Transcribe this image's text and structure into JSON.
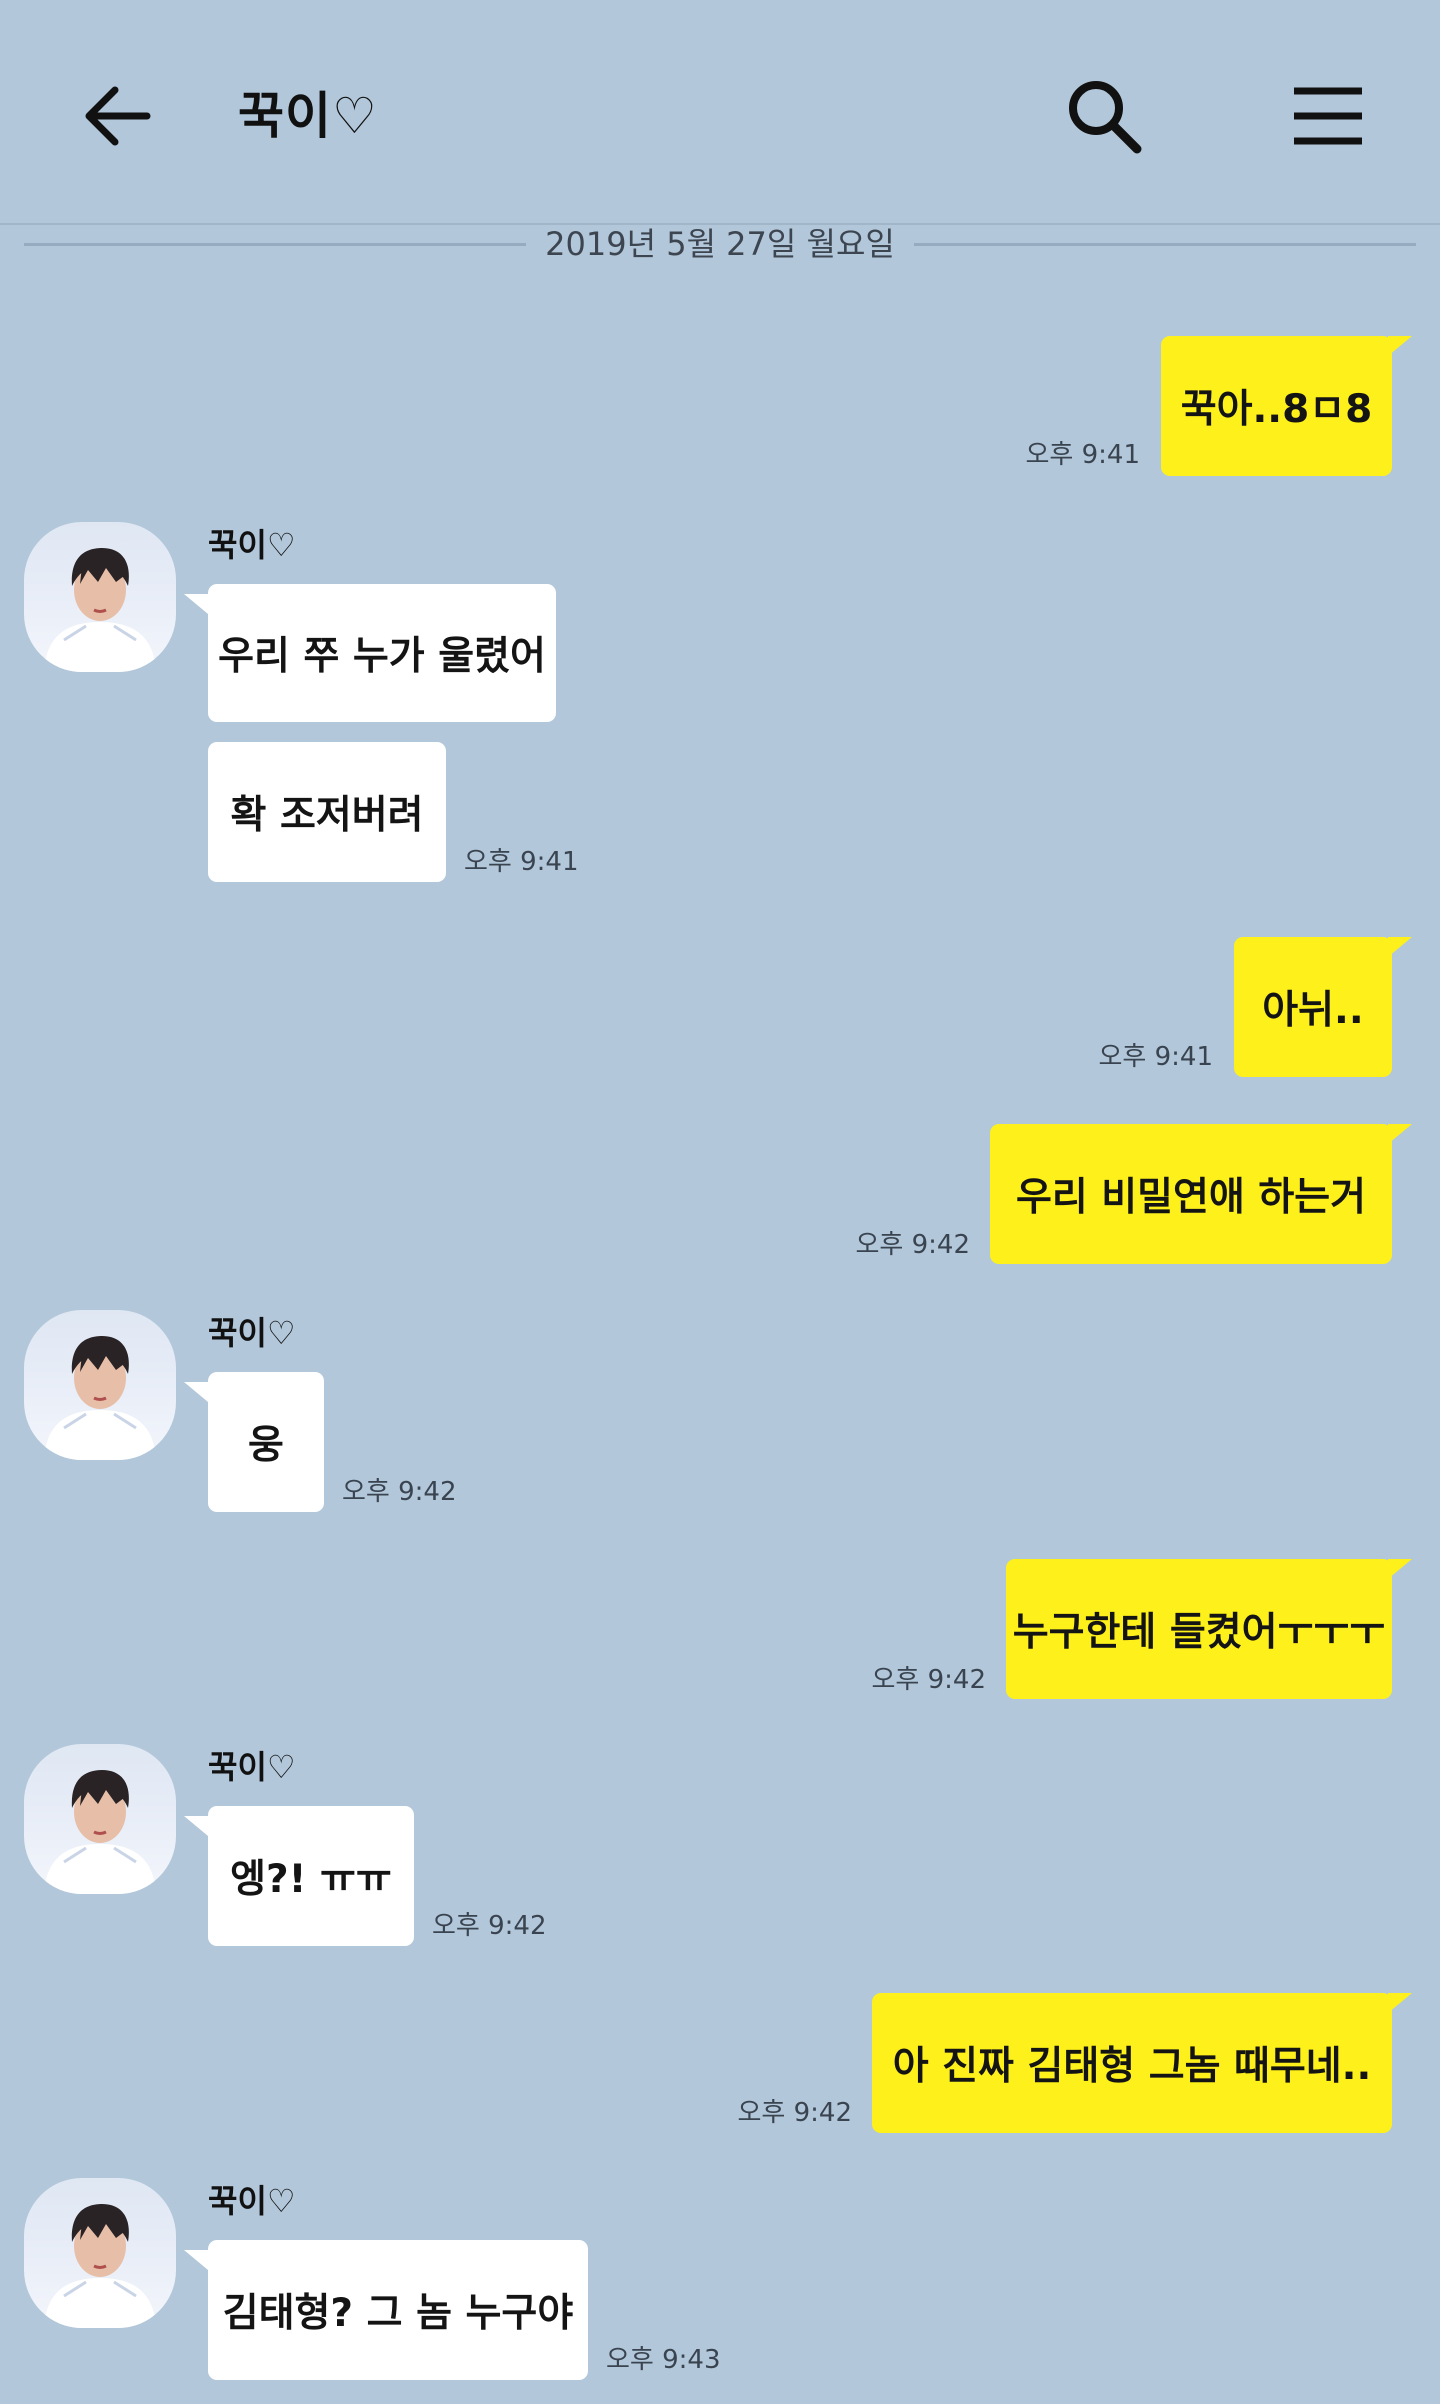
{
  "header": {
    "title": "꾹이♡",
    "back_icon": "arrow-left-icon",
    "search_icon": "search-icon",
    "menu_icon": "hamburger-menu-icon"
  },
  "colors": {
    "background": "#b2c7da",
    "my_bubble": "#fef01b",
    "their_bubble": "#ffffff"
  },
  "date_divider": "2019년 5월 27일 월요일",
  "messages": [
    {
      "from": "me",
      "text": "꾹아..8ㅁ8",
      "time": "오후 9:41"
    },
    {
      "from": "them",
      "sender": "꾹이♡",
      "text": "우리 쭈 누가 울렸어"
    },
    {
      "from": "them",
      "text": "확 조저버려",
      "time": "오후 9:41"
    },
    {
      "from": "me",
      "text": "아뉘..",
      "time": "오후 9:41"
    },
    {
      "from": "me",
      "text": "우리 비밀연애 하는거",
      "time": "오후 9:42"
    },
    {
      "from": "them",
      "sender": "꾹이♡",
      "text": "웅",
      "time": "오후 9:42"
    },
    {
      "from": "me",
      "text": "누구한테 들켰어ㅜㅜㅜ",
      "time": "오후 9:42"
    },
    {
      "from": "them",
      "sender": "꾹이♡",
      "text": "엥?! ㅠㅠ",
      "time": "오후 9:42"
    },
    {
      "from": "me",
      "text": "아 진짜 김태형 그놈 때무네..",
      "time": "오후 9:42"
    },
    {
      "from": "them",
      "sender": "꾹이♡",
      "text": "김태형? 그 놈 누구야",
      "time": "오후 9:43"
    }
  ]
}
